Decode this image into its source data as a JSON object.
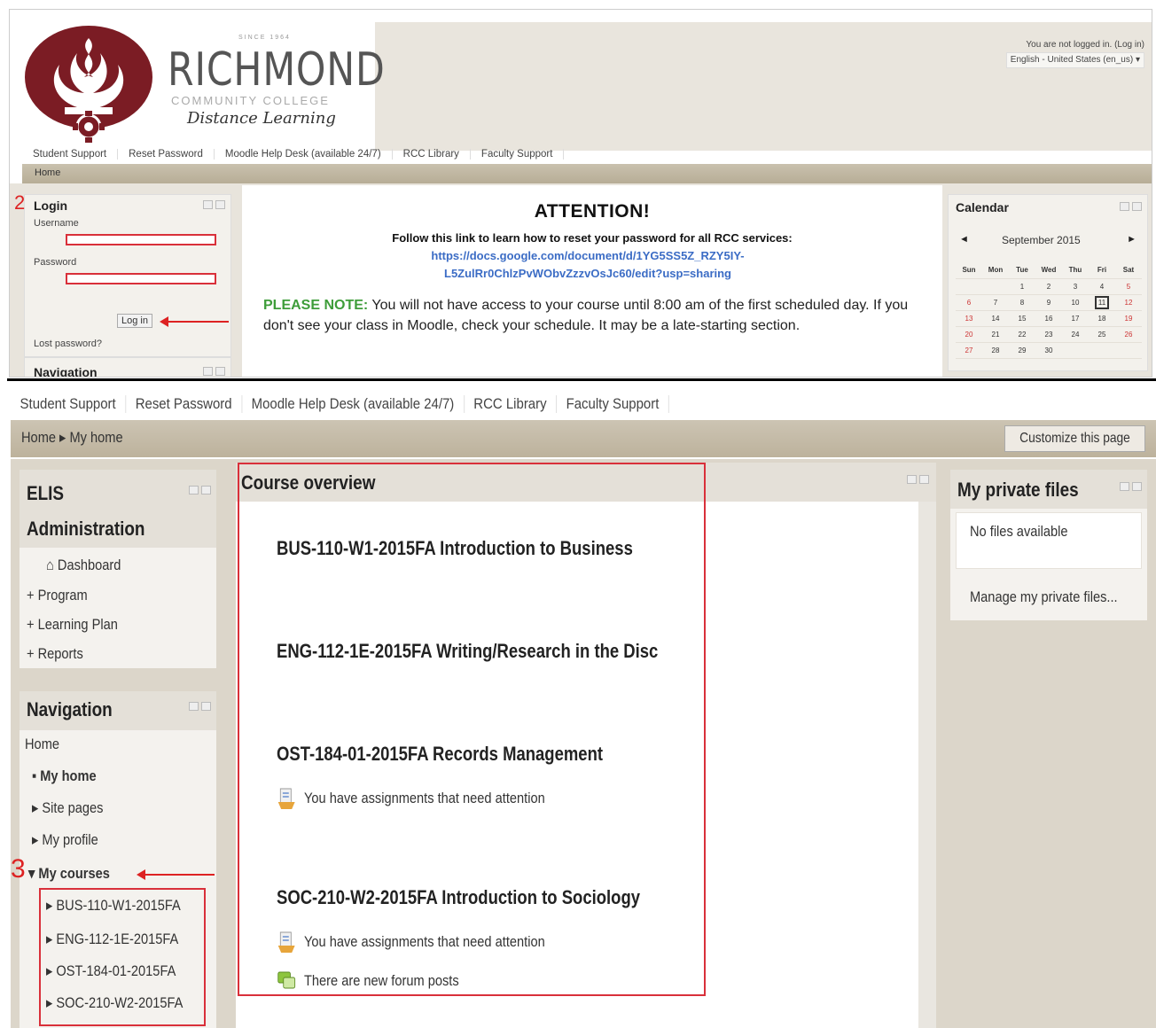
{
  "top": {
    "login_status": "You are not logged in. (Log in)",
    "language": "English - United States (en_us) ▾",
    "brand": {
      "since": "SINCE 1964",
      "name": "RICHMOND",
      "cc": "COMMUNITY COLLEGE",
      "dl": "Distance Learning"
    },
    "menu": [
      "Student Support",
      "Reset Password",
      "Moodle Help Desk (available 24/7)",
      "RCC Library",
      "Faculty Support"
    ],
    "breadcrumb": "Home",
    "login_block": {
      "step": "2",
      "title": "Login",
      "username_label": "Username",
      "password_label": "Password",
      "login_button": "Log in",
      "lost_password": "Lost password?"
    },
    "navigation_title": "Navigation",
    "attention": {
      "title": "ATTENTION!",
      "line": "Follow this link to learn how to reset your password for all RCC services:",
      "link1": "https://docs.google.com/document/d/1YG5SS5Z_RZY5IY-",
      "link2": "L5ZulRr0ChlzPvWObvZzzvOsJc60/edit?usp=sharing",
      "note_label": "PLEASE NOTE:",
      "note_text": "You will not have access to your course until 8:00 am of the first scheduled day.  If you don't see your class in Moodle, check your schedule.  It may be a late-starting section."
    },
    "calendar": {
      "title": "Calendar",
      "prev": "◄",
      "next": "►",
      "month": "September 2015",
      "days": [
        "Sun",
        "Mon",
        "Tue",
        "Wed",
        "Thu",
        "Fri",
        "Sat"
      ],
      "weeks": [
        [
          "",
          "",
          "1",
          "2",
          "3",
          "4",
          "5"
        ],
        [
          "6",
          "7",
          "8",
          "9",
          "10",
          "11",
          "12"
        ],
        [
          "13",
          "14",
          "15",
          "16",
          "17",
          "18",
          "19"
        ],
        [
          "20",
          "21",
          "22",
          "23",
          "24",
          "25",
          "26"
        ],
        [
          "27",
          "28",
          "29",
          "30",
          "",
          "",
          ""
        ]
      ],
      "today": "11"
    }
  },
  "bottom": {
    "menu": [
      "Student Support",
      "Reset Password",
      "Moodle Help Desk (available 24/7)",
      "RCC Library",
      "Faculty Support"
    ],
    "breadcrumb": "Home ▸ My home",
    "customize_button": "Customize this page",
    "elis": {
      "title1": "ELIS",
      "title2": "Administration",
      "items": [
        "Dashboard",
        "Program",
        "Learning Plan",
        "Reports"
      ]
    },
    "navigation": {
      "title": "Navigation",
      "home": "Home",
      "my_home": "My home",
      "site_pages": "Site pages",
      "my_profile": "My profile",
      "my_courses": "My courses",
      "step": "3",
      "courses": [
        "BUS-110-W1-2015FA",
        "ENG-112-1E-2015FA",
        "OST-184-01-2015FA",
        "SOC-210-W2-2015FA"
      ]
    },
    "course_overview": {
      "title": "Course overview",
      "courses": [
        {
          "title": "BUS-110-W1-2015FA Introduction to Business",
          "notes": []
        },
        {
          "title": "ENG-112-1E-2015FA Writing/Research in the Disc",
          "notes": []
        },
        {
          "title": "OST-184-01-2015FA Records Management",
          "notes": [
            "You have assignments that need attention"
          ]
        },
        {
          "title": "SOC-210-W2-2015FA Introduction to Sociology",
          "notes": [
            "You have assignments that need attention",
            "There are new forum posts"
          ]
        }
      ]
    },
    "private_files": {
      "title": "My private files",
      "empty": "No files available",
      "manage": "Manage my private files..."
    }
  },
  "colors": {
    "accent_red": "#d9303a",
    "link_blue": "#3b6cc5",
    "note_green": "#3e9d3a",
    "logo_maroon": "#7b1c24"
  }
}
